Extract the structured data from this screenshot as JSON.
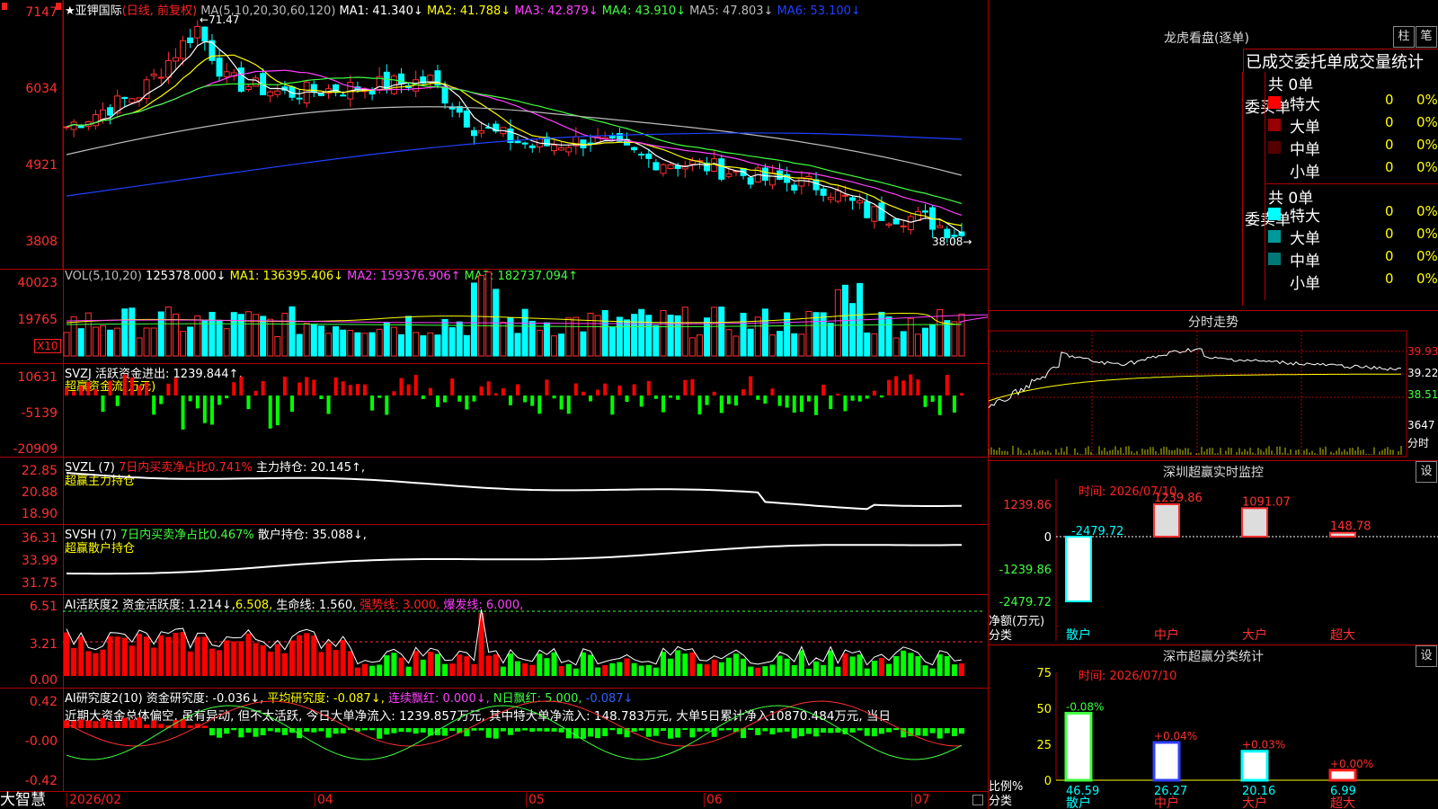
{
  "stock": {
    "name_line": "★亚钾国际",
    "period": "(日线, 前复权)",
    "ma_label": "MA(5,10,20,30,60,120)",
    "ma": [
      {
        "label": "MA1: 41.340↓",
        "color": "#ffffff"
      },
      {
        "label": "MA2: 41.788↓",
        "color": "#ffff00"
      },
      {
        "label": "MA3: 42.879↓",
        "color": "#ff40ff"
      },
      {
        "label": "MA4: 43.910↓",
        "color": "#40ff40"
      },
      {
        "label": "MA5: 47.803↓",
        "color": "#bbbbbb"
      },
      {
        "label": "MA6: 53.100↓",
        "color": "#2040ff"
      }
    ],
    "high_label": "71.47",
    "low_label": "38.08",
    "price_axis": [
      "7147",
      "6034",
      "4921",
      "3808"
    ]
  },
  "vol": {
    "header": "VOL(5,10,20)",
    "value": "125378.000↓",
    "ma": [
      {
        "label": "MA1: 136395.406↓",
        "color": "#ffff00"
      },
      {
        "label": "MA2: 159376.906↑",
        "color": "#ff40ff"
      },
      {
        "label": "MA3: 182737.094↑",
        "color": "#40ff40"
      }
    ],
    "axis": [
      "40023",
      "19765"
    ],
    "unit": "X10"
  },
  "svzj": {
    "header": "SVZJ  活跃资金进出: 1239.844↑,",
    "sub": "超赢资金流(万元)",
    "axis": [
      "10631",
      "-5139",
      "-20909"
    ]
  },
  "svzl": {
    "header": "SVZL (7)",
    "pct": "7日内买卖净占比0.741%",
    "hold": "主力持仓: 20.145↑,",
    "sub": "超赢主力持仓",
    "axis": [
      "22.85",
      "20.88",
      "18.90"
    ]
  },
  "svsh": {
    "header": "SVSH (7)",
    "pct": "7日内买卖净占比0.467%",
    "hold": "散户持仓: 35.088↓,",
    "sub": "超赢散户持仓",
    "axis": [
      "36.31",
      "33.99",
      "31.75"
    ]
  },
  "ai1": {
    "header": "AI活跃度2 资金活跃度: 1.214↓,",
    "v2": "6.508,",
    "life": "生命线: 1.560,",
    "strong": "强势线: 3.000,",
    "burst": "爆发线: 6.000,",
    "axis": [
      "6.51",
      "3.21",
      "0.00"
    ]
  },
  "ai2": {
    "header": "AI研究度2(10) 资金研究度: -0.036↓,",
    "avg": "平均研究度: -0.087↓,",
    "lian": "连续飘红: 0.000↓,",
    "nri": "N日飘红: 5.000,",
    "n2": "-0.087↓",
    "comment": "近期大资金总体偏空, 虽有异动, 但不太活跃, 今日大单净流入: 1239.857万元, 其中特大单净流入: 148.783万元, 大单5日累计净入10870.484万元, 当日",
    "axis": [
      "0.42",
      "-0.00",
      "-0.42"
    ]
  },
  "dates": [
    "2026/02",
    "04",
    "05",
    "06",
    "07"
  ],
  "footer_brand": "大智慧",
  "dragon": {
    "title": "龙虎看盘(逐单)",
    "btn1": "柱",
    "btn2": "笔",
    "section": "已成交委托单成交量统计",
    "buy": {
      "label": "委买单",
      "total": "共 0单",
      "rows": [
        {
          "name": "特大",
          "v": "0",
          "p": "0%",
          "color": "#ff0000"
        },
        {
          "name": "大单",
          "v": "0",
          "p": "0%",
          "color": "#990000"
        },
        {
          "name": "中单",
          "v": "0",
          "p": "0%",
          "color": "#550000"
        },
        {
          "name": "小单",
          "v": "0",
          "p": "0%",
          "color": "#000000"
        }
      ]
    },
    "sell": {
      "label": "委卖单",
      "total": "共 0单",
      "rows": [
        {
          "name": "特大",
          "v": "0",
          "p": "0%",
          "color": "#00ffff"
        },
        {
          "name": "大单",
          "v": "0",
          "p": "0%",
          "color": "#009999"
        },
        {
          "name": "中单",
          "v": "0",
          "p": "0%",
          "color": "#007777"
        },
        {
          "name": "小单",
          "v": "0",
          "p": "0%",
          "color": "#000000"
        }
      ]
    }
  },
  "intraday": {
    "title": "分时走势",
    "axis": [
      "39.93",
      "39.22",
      "38.51"
    ],
    "vol_axis": "3647",
    "vol_unit": "分时"
  },
  "monitor": {
    "title": "深圳超赢实时监控",
    "btn": "设",
    "time": "时间: 2026/07/10",
    "axis": [
      "1239.86",
      "0",
      "-1239.86",
      "-2479.72"
    ],
    "ylabel": "净额(万元)",
    "xlabel": "分类",
    "bars": [
      {
        "cat": "散户",
        "label": "-2479.72",
        "value": -2479.72,
        "color": "#00ffff"
      },
      {
        "cat": "中户",
        "label": "1239.86",
        "value": 1239.86,
        "color": "#ffffff"
      },
      {
        "cat": "大户",
        "label": "1091.07",
        "value": 1091.07,
        "color": "#ffffff"
      },
      {
        "cat": "超大",
        "label": "148.78",
        "value": 148.78,
        "color": "#ffffff"
      }
    ]
  },
  "classify": {
    "title": "深市超赢分类统计",
    "btn": "设",
    "time": "时间: 2026/07/10",
    "axis": [
      "75",
      "50",
      "25",
      "0"
    ],
    "ylabel": "比例%",
    "xlabel": "分类",
    "bars": [
      {
        "cat": "散户",
        "top": "-0.08%",
        "bottom": "46.59",
        "value": 46.59,
        "color": "#40ff40"
      },
      {
        "cat": "中户",
        "top": "+0.04%",
        "bottom": "26.27",
        "value": 26.27,
        "color": "#3040ff"
      },
      {
        "cat": "大户",
        "top": "+0.03%",
        "bottom": "20.16",
        "value": 20.16,
        "color": "#00ffff"
      },
      {
        "cat": "超大",
        "top": "+0.00%",
        "bottom": "6.99",
        "value": 6.99,
        "color": "#ff2020"
      }
    ]
  },
  "chart_data": {
    "type": "candlestick",
    "title": "亚钾国际",
    "price_high": 71.47,
    "price_low": 38.08,
    "ylim": [
      38.08,
      71.47
    ]
  }
}
